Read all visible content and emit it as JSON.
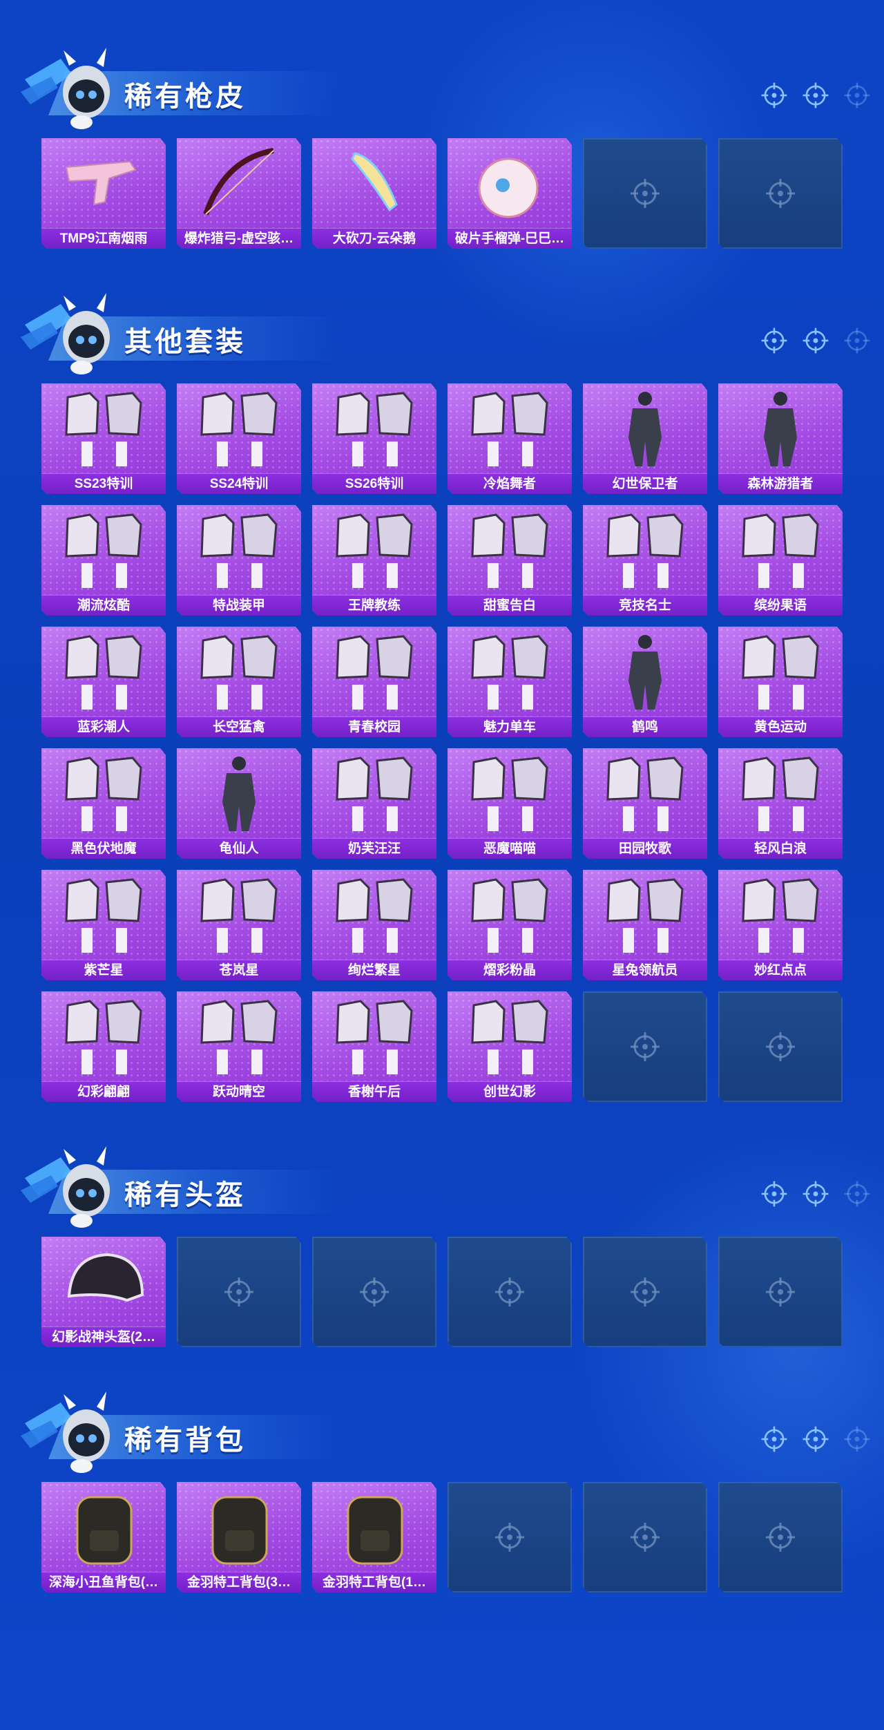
{
  "colors": {
    "background": "#0d45c6",
    "card_filled": "#a64ce4",
    "card_label": "#7420c7",
    "card_empty": "#1f4b8e",
    "crosshair": "#8cc0ff"
  },
  "sections": [
    {
      "title": "稀有枪皮",
      "items": [
        {
          "name": "TMP9江南烟雨",
          "icon": "smg-skin-icon",
          "empty": false
        },
        {
          "name": "爆炸猎弓-虚空骇…",
          "icon": "bow-skin-icon",
          "empty": false
        },
        {
          "name": "大砍刀-云朵鹅",
          "icon": "machete-skin-icon",
          "empty": false
        },
        {
          "name": "破片手榴弹-巳巳…",
          "icon": "grenade-skin-icon",
          "empty": false
        },
        {
          "name": "",
          "icon": "crosshair-icon",
          "empty": true
        },
        {
          "name": "",
          "icon": "crosshair-icon",
          "empty": true
        }
      ]
    },
    {
      "title": "其他套装",
      "items": [
        {
          "name": "SS23特训",
          "icon": "outfit-set-icon",
          "empty": false
        },
        {
          "name": "SS24特训",
          "icon": "outfit-set-icon",
          "empty": false
        },
        {
          "name": "SS26特训",
          "icon": "outfit-set-icon",
          "empty": false
        },
        {
          "name": "冷焰舞者",
          "icon": "outfit-set-icon",
          "empty": false
        },
        {
          "name": "幻世保卫者",
          "icon": "outfit-figure-icon",
          "empty": false
        },
        {
          "name": "森林游猎者",
          "icon": "outfit-figure-icon",
          "empty": false
        },
        {
          "name": "潮流炫酷",
          "icon": "outfit-set-icon",
          "empty": false
        },
        {
          "name": "特战装甲",
          "icon": "outfit-set-icon",
          "empty": false
        },
        {
          "name": "王牌教练",
          "icon": "outfit-set-icon",
          "empty": false
        },
        {
          "name": "甜蜜告白",
          "icon": "outfit-set-icon",
          "empty": false
        },
        {
          "name": "竞技名士",
          "icon": "outfit-set-icon",
          "empty": false
        },
        {
          "name": "缤纷果语",
          "icon": "outfit-set-icon",
          "empty": false
        },
        {
          "name": "蓝彩潮人",
          "icon": "outfit-set-icon",
          "empty": false
        },
        {
          "name": "长空猛禽",
          "icon": "outfit-set-icon",
          "empty": false
        },
        {
          "name": "青春校园",
          "icon": "outfit-set-icon",
          "empty": false
        },
        {
          "name": "魅力单车",
          "icon": "outfit-set-icon",
          "empty": false
        },
        {
          "name": "鹤鸣",
          "icon": "outfit-hoodie-icon",
          "empty": false
        },
        {
          "name": "黄色运动",
          "icon": "outfit-set-icon",
          "empty": false
        },
        {
          "name": "黑色伏地魔",
          "icon": "outfit-set-icon",
          "empty": false
        },
        {
          "name": "龟仙人",
          "icon": "outfit-shirt-icon",
          "empty": false
        },
        {
          "name": "奶芙汪汪",
          "icon": "outfit-set-icon",
          "empty": false
        },
        {
          "name": "恶魔喵喵",
          "icon": "outfit-set-icon",
          "empty": false
        },
        {
          "name": "田园牧歌",
          "icon": "outfit-set-icon",
          "empty": false
        },
        {
          "name": "轻风白浪",
          "icon": "outfit-set-icon",
          "empty": false
        },
        {
          "name": "紫芒星",
          "icon": "outfit-set-icon",
          "empty": false
        },
        {
          "name": "苍岚星",
          "icon": "outfit-set-icon",
          "empty": false
        },
        {
          "name": "绚烂繁星",
          "icon": "outfit-set-icon",
          "empty": false
        },
        {
          "name": "熠彩粉晶",
          "icon": "outfit-set-icon",
          "empty": false
        },
        {
          "name": "星兔领航员",
          "icon": "outfit-set-icon",
          "empty": false
        },
        {
          "name": "妙红点点",
          "icon": "outfit-set-icon",
          "empty": false
        },
        {
          "name": "幻彩翩翩",
          "icon": "outfit-set-icon",
          "empty": false
        },
        {
          "name": "跃动晴空",
          "icon": "outfit-set-icon",
          "empty": false
        },
        {
          "name": "香榭午后",
          "icon": "outfit-set-icon",
          "empty": false
        },
        {
          "name": "创世幻影",
          "icon": "outfit-set-icon",
          "empty": false
        },
        {
          "name": "",
          "icon": "crosshair-icon",
          "empty": true
        },
        {
          "name": "",
          "icon": "crosshair-icon",
          "empty": true
        }
      ]
    },
    {
      "title": "稀有头盔",
      "items": [
        {
          "name": "幻影战神头盔(2…",
          "icon": "helmet-icon",
          "empty": false
        },
        {
          "name": "",
          "icon": "crosshair-icon",
          "empty": true
        },
        {
          "name": "",
          "icon": "crosshair-icon",
          "empty": true
        },
        {
          "name": "",
          "icon": "crosshair-icon",
          "empty": true
        },
        {
          "name": "",
          "icon": "crosshair-icon",
          "empty": true
        },
        {
          "name": "",
          "icon": "crosshair-icon",
          "empty": true
        }
      ]
    },
    {
      "title": "稀有背包",
      "items": [
        {
          "name": "深海小丑鱼背包(…",
          "icon": "backpack-icon",
          "empty": false
        },
        {
          "name": "金羽特工背包(3…",
          "icon": "backpack-icon",
          "empty": false
        },
        {
          "name": "金羽特工背包(1…",
          "icon": "backpack-icon",
          "empty": false
        },
        {
          "name": "",
          "icon": "crosshair-icon",
          "empty": true
        },
        {
          "name": "",
          "icon": "crosshair-icon",
          "empty": true
        },
        {
          "name": "",
          "icon": "crosshair-icon",
          "empty": true
        }
      ]
    }
  ]
}
